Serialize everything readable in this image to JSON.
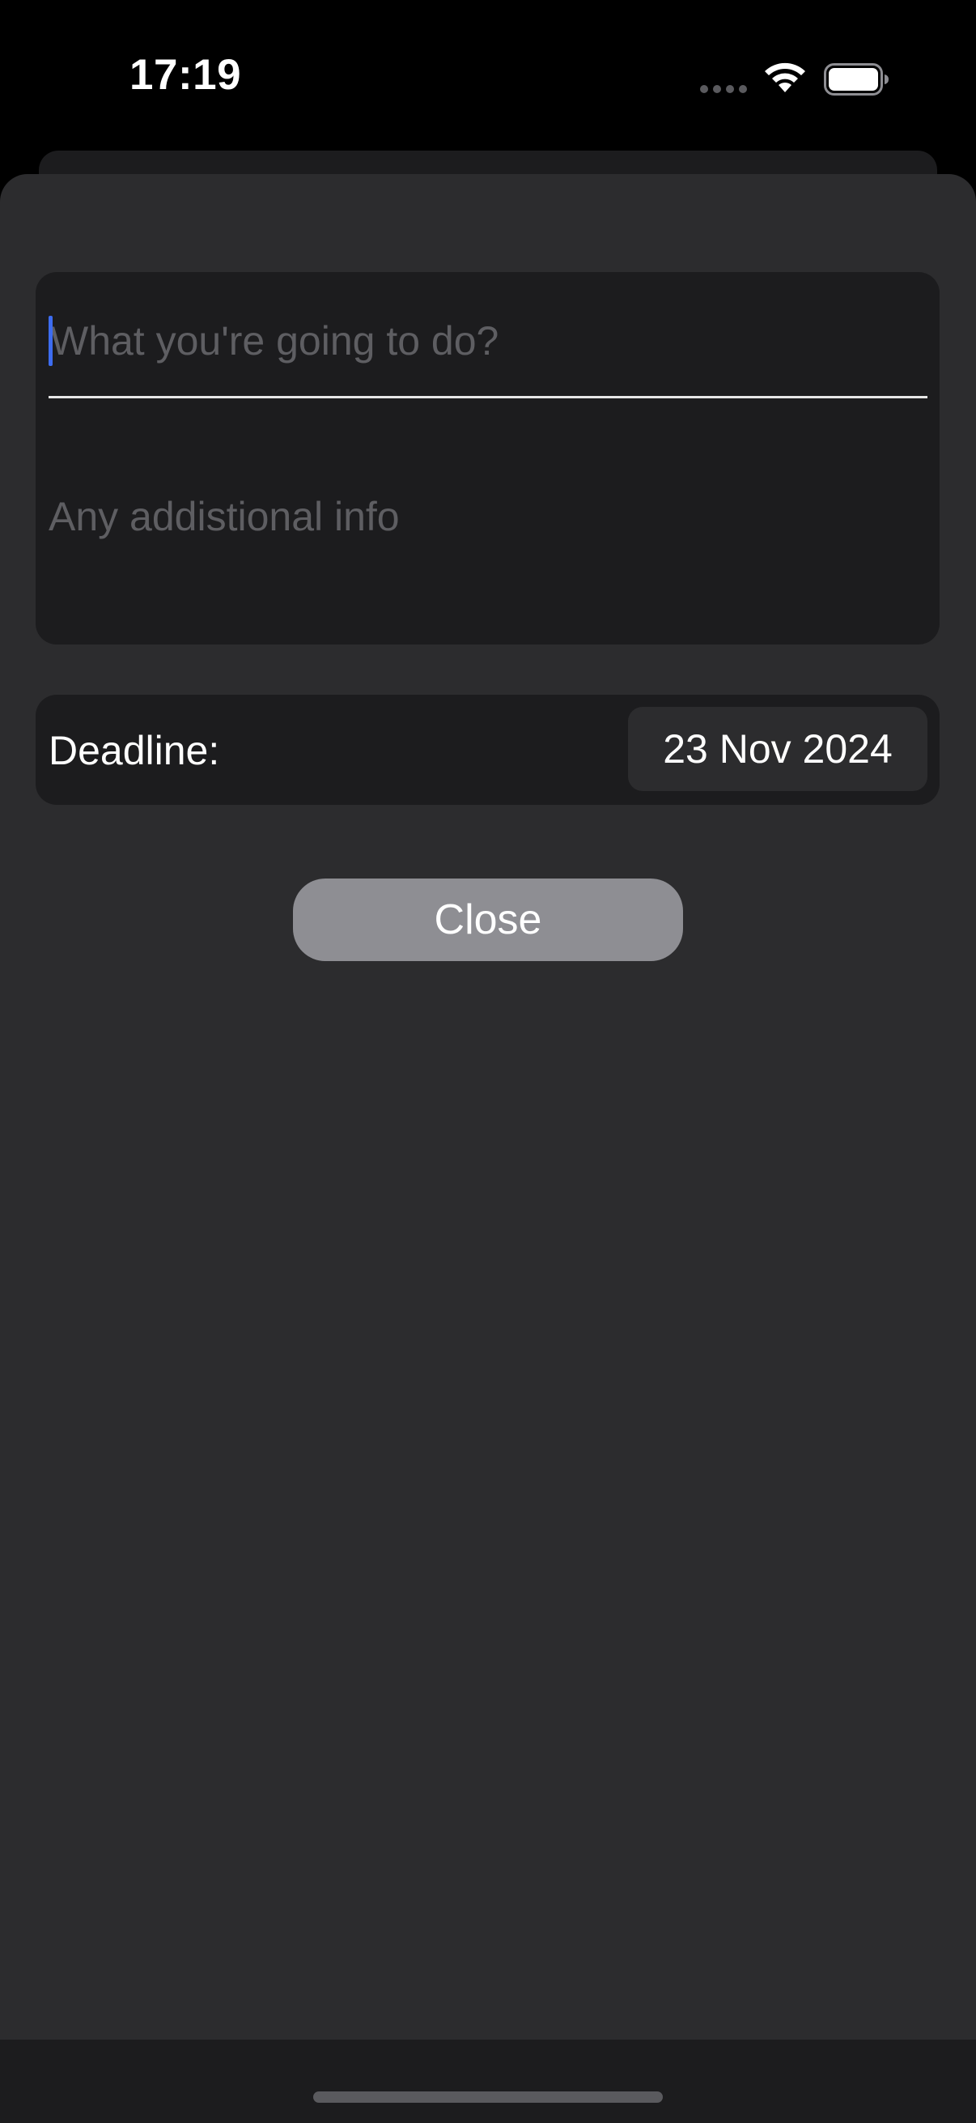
{
  "status_bar": {
    "time": "17:19",
    "icons": [
      "signal-dots-icon",
      "wifi-icon",
      "battery-icon"
    ]
  },
  "form": {
    "title_input": {
      "value": "",
      "placeholder": "What you're going to do?"
    },
    "notes_input": {
      "value": "",
      "placeholder": "Any addistional info"
    },
    "deadline": {
      "label": "Deadline:",
      "date": "23 Nov 2024"
    },
    "close_label": "Close"
  },
  "colors": {
    "background": "#000000",
    "sheet": "#2c2c2e",
    "card": "#1c1c1e",
    "placeholder": "#5e5e62",
    "cursor": "#3d6cf0",
    "close_button": "#8e8e93",
    "text": "#ffffff"
  }
}
